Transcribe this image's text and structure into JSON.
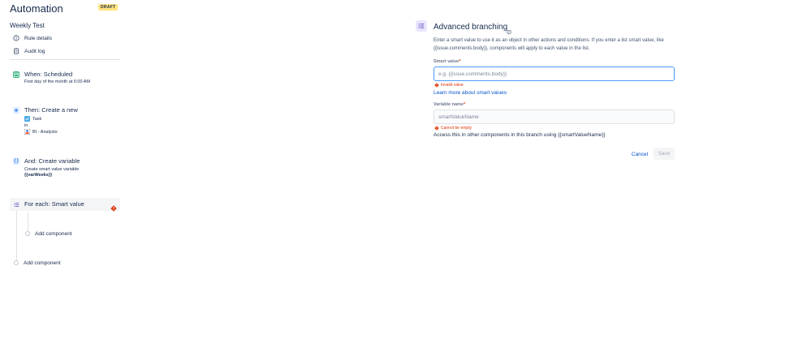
{
  "header": {
    "title": "Automation",
    "badge": "DRAFT"
  },
  "rule": {
    "name": "Weekly Test"
  },
  "nav": [
    {
      "label": "Rule details",
      "icon": "info-icon"
    },
    {
      "label": "Audit log",
      "icon": "clipboard-icon"
    }
  ],
  "steps": {
    "when": {
      "title": "When: Scheduled",
      "subtitle": "First day of the month at 6:00 AM",
      "color": "#36b37e"
    },
    "then": {
      "title": "Then: Create a new",
      "issue_type": "Task",
      "preposition": "in",
      "project": "BI - Analysts",
      "color": "#0065ff"
    },
    "and": {
      "title": "And: Create variable",
      "subtitle": "Create smart value variable",
      "variable": "{{varWeeks}}",
      "color": "#0065ff"
    },
    "foreach": {
      "title": "For each: Smart value",
      "icon": "list-icon",
      "error_icon": "error-icon",
      "color": "#6554c0"
    }
  },
  "add_component_inner": "Add component",
  "add_component_outer": "Add component",
  "panel": {
    "title": "Advanced branching",
    "description": "Enter a smart value to use it as an object in other actions and conditions. If you enter a list smart value, like {{issue.comments.body}}, components will apply to each value in the list.",
    "smart_value_label": "Smart value",
    "smart_value_placeholder": "e.g. {{issue.comments.body}}",
    "smart_value_value": "",
    "smart_value_error": "Invalid value",
    "learn_more": "Learn more about smart values",
    "variable_label": "Variable name",
    "variable_placeholder": "smartValueName",
    "variable_value": "",
    "variable_error": "Cannot be empty",
    "access_text": "Access this in other components in this branch using {{smartValueName}}",
    "cancel_label": "Cancel",
    "save_label": "Save",
    "required_marker": "*"
  },
  "colors": {
    "accent": "#0052cc",
    "error": "#de350b",
    "badge": "#ffe380"
  }
}
